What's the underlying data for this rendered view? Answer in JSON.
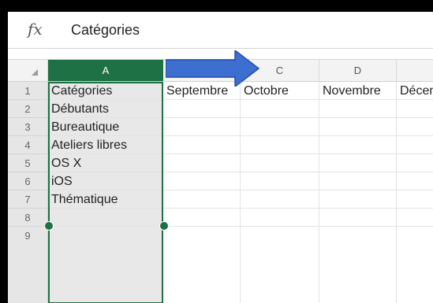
{
  "formula_bar": {
    "fx_label": "fx",
    "value": "Catégories"
  },
  "columns": [
    "A",
    "C",
    "D"
  ],
  "rows": [
    "1",
    "2",
    "3",
    "4",
    "5",
    "6",
    "7",
    "8",
    "9"
  ],
  "cells": {
    "A": [
      "Catégories",
      "Débutants",
      "Bureautique",
      "Ateliers libres",
      "OS X",
      "iOS",
      "Thématique",
      "",
      ""
    ],
    "B1": "Septembre",
    "C1": "Octobre",
    "D1": "Novembre",
    "E1": "Décembre"
  },
  "colors": {
    "selection_green": "#1e7145",
    "arrow_blue": "#3d6fd1"
  }
}
